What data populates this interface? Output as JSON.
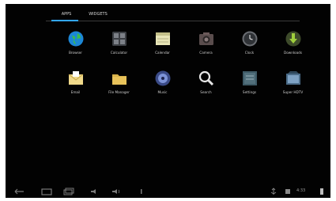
{
  "tabs": [
    {
      "label": "APPS",
      "active": true
    },
    {
      "label": "WIDGETS",
      "active": false
    }
  ],
  "apps_row1": [
    {
      "label": "Browser",
      "icon": "globe-icon"
    },
    {
      "label": "Calculator",
      "icon": "calculator-icon"
    },
    {
      "label": "Calendar",
      "icon": "calendar-icon"
    },
    {
      "label": "Camera",
      "icon": "camera-icon"
    },
    {
      "label": "Clock",
      "icon": "clock-icon"
    },
    {
      "label": "Downloads",
      "icon": "download-icon"
    }
  ],
  "apps_row2": [
    {
      "label": "Email",
      "icon": "email-icon"
    },
    {
      "label": "File Manager",
      "icon": "folder-icon"
    },
    {
      "label": "Music",
      "icon": "music-icon"
    },
    {
      "label": "Search",
      "icon": "search-icon"
    },
    {
      "label": "Settings",
      "icon": "settings-icon"
    },
    {
      "label": "Super HDTV",
      "icon": "hdtv-icon"
    }
  ],
  "status": {
    "time": "4:33"
  },
  "colors": {
    "accent": "#32a7ff",
    "background": "#020202",
    "label": "#cfcfcf"
  }
}
